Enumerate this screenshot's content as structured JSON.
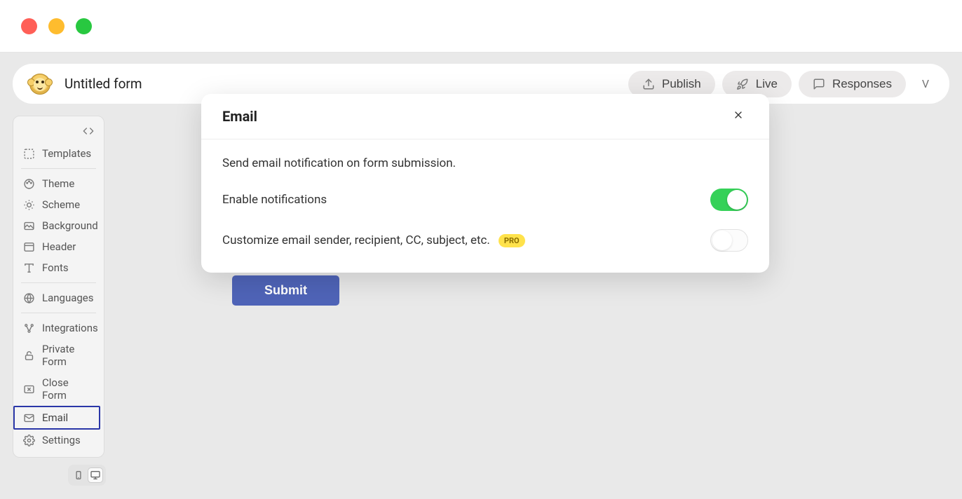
{
  "window": {
    "title": "Untitled form"
  },
  "topbar": {
    "form_title": "Untitled form",
    "publish_label": "Publish",
    "live_label": "Live",
    "responses_label": "Responses",
    "avatar_initial": "V"
  },
  "sidebar": {
    "templates": "Templates",
    "theme": "Theme",
    "scheme": "Scheme",
    "background": "Background",
    "header": "Header",
    "fonts": "Fonts",
    "languages": "Languages",
    "integrations": "Integrations",
    "private_form": "Private Form",
    "close_form": "Close Form",
    "email": "Email",
    "settings": "Settings"
  },
  "canvas": {
    "submit_label": "Submit"
  },
  "modal": {
    "title": "Email",
    "description": "Send email notification on form submission.",
    "enable_label": "Enable notifications",
    "enable_value": true,
    "customize_label": "Customize email sender, recipient, CC, subject, etc.",
    "customize_value": false,
    "pro_badge": "PRO"
  }
}
